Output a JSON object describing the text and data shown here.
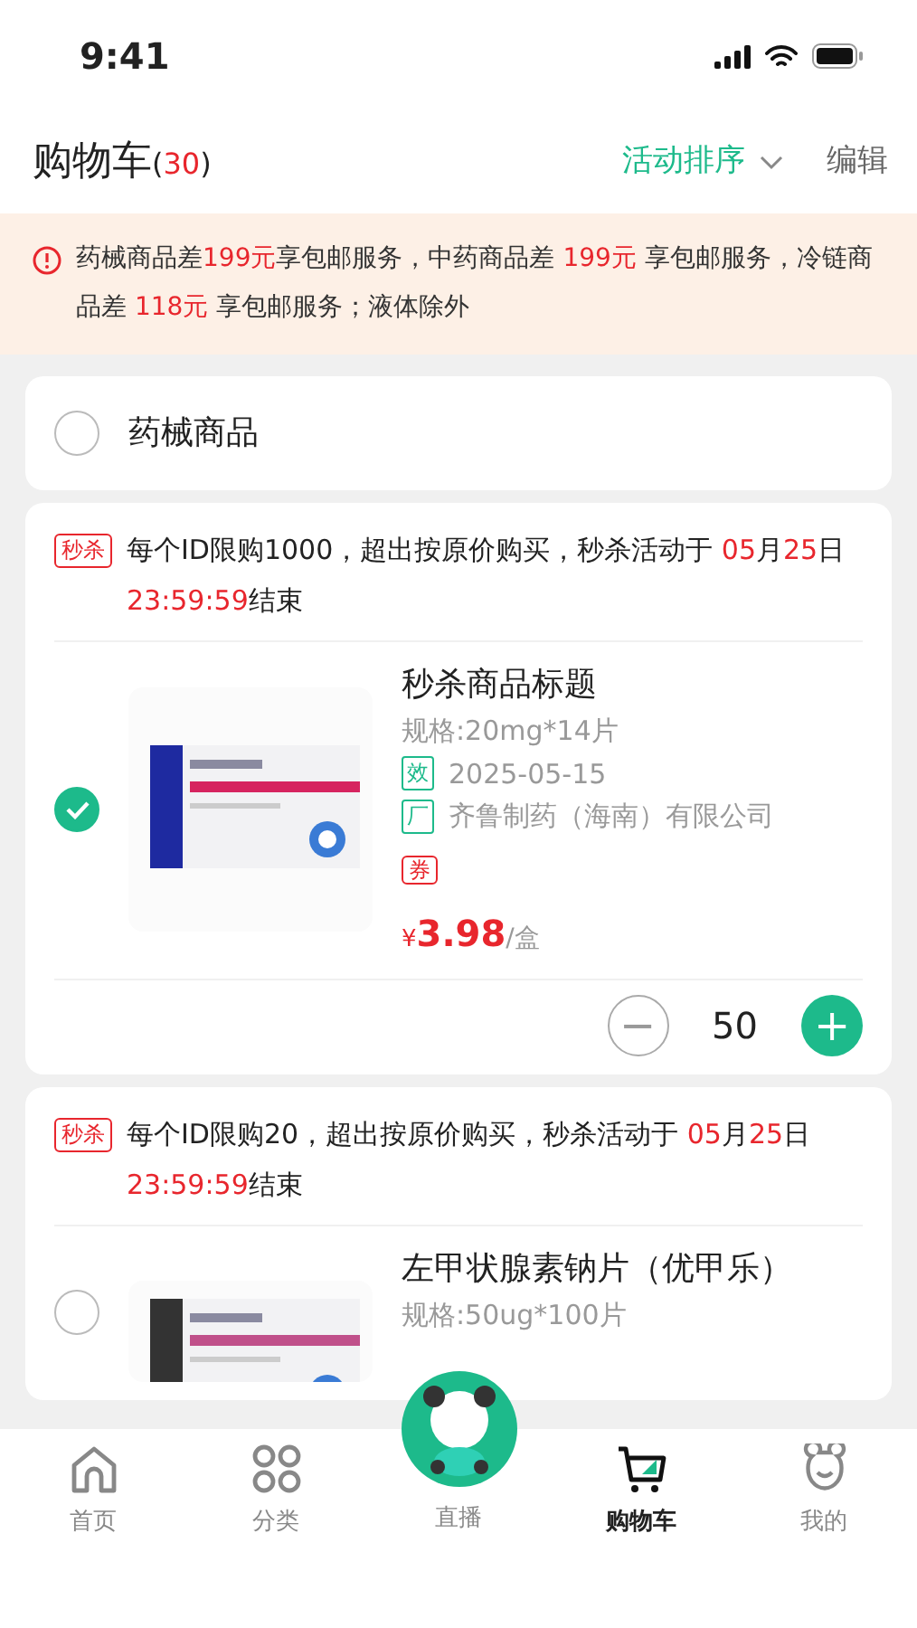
{
  "status_bar": {
    "time": "9:41"
  },
  "header": {
    "title": "购物车",
    "count_open": "(",
    "count": "30",
    "count_close": ")",
    "sort": "活动排序",
    "edit": "编辑"
  },
  "notice": {
    "segments": [
      {
        "text": "药械商品差",
        "highlight": false
      },
      {
        "text": "199元",
        "highlight": true
      },
      {
        "text": "享包邮服务，中药商品差 ",
        "highlight": false
      },
      {
        "text": "199元",
        "highlight": true
      },
      {
        "text": " 享包邮服务，冷链商品差 ",
        "highlight": false
      },
      {
        "text": "118元",
        "highlight": true
      },
      {
        "text": " 享包邮服务；液体除外",
        "highlight": false
      }
    ]
  },
  "group": {
    "title": "药械商品",
    "checked": false
  },
  "items": [
    {
      "tag": "秒杀",
      "promo": [
        {
          "text": "每个ID限购1000，超出按原价购买，秒杀活动于 ",
          "highlight": false
        },
        {
          "text": "05",
          "highlight": true
        },
        {
          "text": "月",
          "highlight": false
        },
        {
          "text": "25",
          "highlight": true
        },
        {
          "text": "日 ",
          "highlight": false
        },
        {
          "text": "23:59:59",
          "highlight": true
        },
        {
          "text": "结束",
          "highlight": false
        }
      ],
      "checked": true,
      "title": "秒杀商品标题",
      "spec": "规格:20mg*14片",
      "expiry_badge": "效",
      "expiry": "2025-05-15",
      "maker_badge": "厂",
      "maker": "齐鲁制药（海南）有限公司",
      "coupon": "券",
      "currency": "¥",
      "price": "3.98",
      "unit": "/盒",
      "quantity": "50",
      "minus": "−",
      "plus": "+"
    },
    {
      "tag": "秒杀",
      "promo": [
        {
          "text": "每个ID限购20，超出按原价购买，秒杀活动于 ",
          "highlight": false
        },
        {
          "text": "05",
          "highlight": true
        },
        {
          "text": "月",
          "highlight": false
        },
        {
          "text": "25",
          "highlight": true
        },
        {
          "text": "日 ",
          "highlight": false
        },
        {
          "text": "23:59:59",
          "highlight": true
        },
        {
          "text": "结束",
          "highlight": false
        }
      ],
      "checked": false,
      "title": "左甲状腺素钠片（优甲乐）",
      "spec": "规格:50ug*100片"
    }
  ],
  "tabbar": [
    {
      "label": "首页",
      "selected": false
    },
    {
      "label": "分类",
      "selected": false
    },
    {
      "label": "直播",
      "selected": false
    },
    {
      "label": "购物车",
      "selected": true
    },
    {
      "label": "我的",
      "selected": false
    }
  ]
}
